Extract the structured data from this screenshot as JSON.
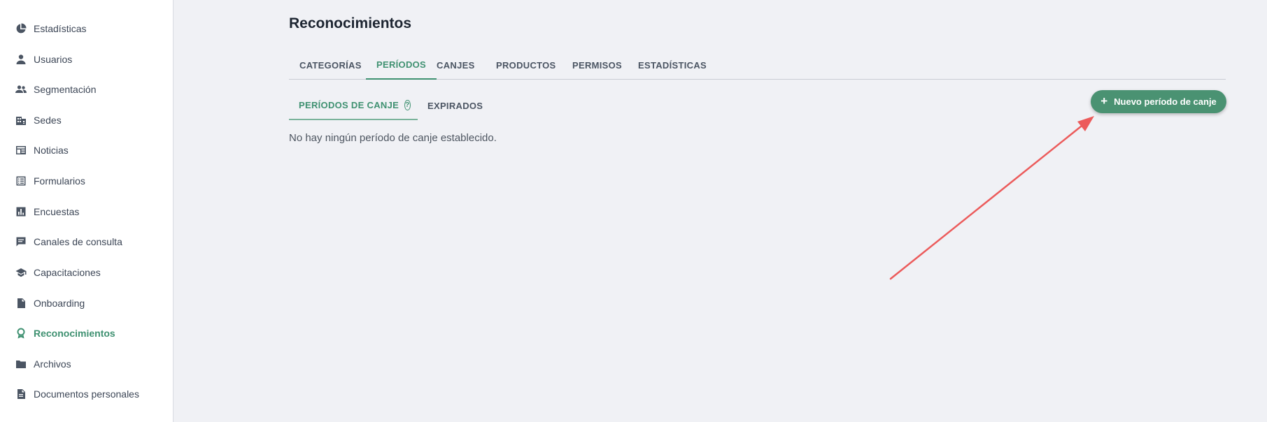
{
  "sidebar": {
    "items": [
      {
        "label": "Estadísticas",
        "icon": "pie-chart-icon"
      },
      {
        "label": "Usuarios",
        "icon": "user-icon"
      },
      {
        "label": "Segmentación",
        "icon": "group-icon"
      },
      {
        "label": "Sedes",
        "icon": "building-icon"
      },
      {
        "label": "Noticias",
        "icon": "newspaper-icon"
      },
      {
        "label": "Formularios",
        "icon": "list-form-icon"
      },
      {
        "label": "Encuestas",
        "icon": "bar-chart-icon"
      },
      {
        "label": "Canales de consulta",
        "icon": "chat-icon"
      },
      {
        "label": "Capacitaciones",
        "icon": "graduation-cap-icon"
      },
      {
        "label": "Onboarding",
        "icon": "checklist-document-icon"
      },
      {
        "label": "Reconocimientos",
        "icon": "award-icon"
      },
      {
        "label": "Archivos",
        "icon": "folder-icon"
      },
      {
        "label": "Documentos personales",
        "icon": "document-icon"
      }
    ],
    "active_label": "Reconocimientos"
  },
  "header": {
    "title": "Reconocimientos"
  },
  "tabs": [
    {
      "label": "CATEGORÍAS"
    },
    {
      "label": "PERÍODOS"
    },
    {
      "label": "CANJES"
    },
    {
      "label": "PRODUCTOS"
    },
    {
      "label": "PERMISOS"
    },
    {
      "label": "ESTADÍSTICAS"
    }
  ],
  "active_tab": "PERÍODOS",
  "subtabs": [
    {
      "label": "PERÍODOS DE CANJE"
    },
    {
      "label": "EXPIRADOS"
    }
  ],
  "active_subtab": "PERÍODOS DE CANJE",
  "empty_message": "No hay ningún período de canje establecido.",
  "new_button": {
    "label": "Nuevo período de canje",
    "icon": "plus-icon"
  },
  "colors": {
    "accent": "#3f9171",
    "button": "#4a9272",
    "background": "#f0f1f5",
    "annotation_arrow": "#ec5b5b"
  }
}
